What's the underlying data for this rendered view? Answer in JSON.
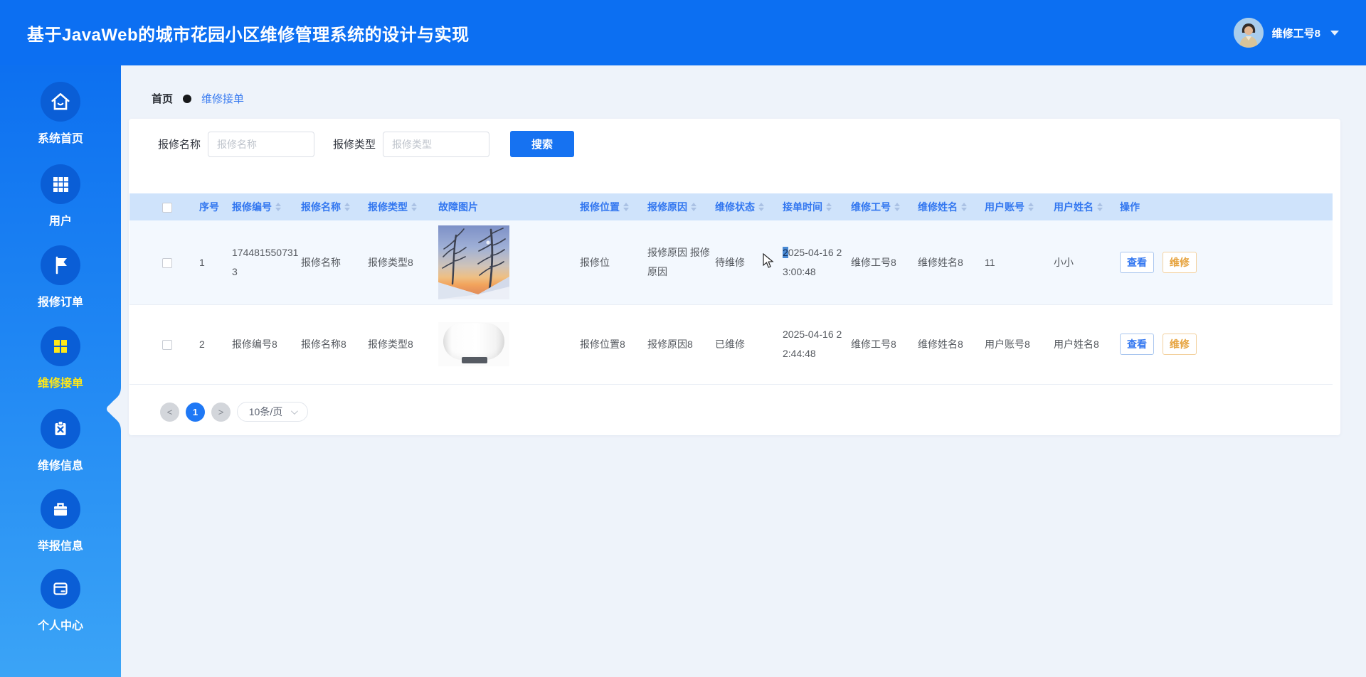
{
  "header": {
    "title": "基于JavaWeb的城市花园小区维修管理系统的设计与实现",
    "user_name": "维修工号8"
  },
  "sidebar": {
    "items": [
      {
        "label": "系统首页",
        "icon": "home"
      },
      {
        "label": "用户",
        "icon": "grid-3x3"
      },
      {
        "label": "报修订单",
        "icon": "flag"
      },
      {
        "label": "维修接单",
        "icon": "grid-2x2",
        "active": true
      },
      {
        "label": "维修信息",
        "icon": "clipboard-x"
      },
      {
        "label": "举报信息",
        "icon": "briefcase"
      },
      {
        "label": "个人中心",
        "icon": "id-card"
      }
    ]
  },
  "breadcrumb": {
    "home": "首页",
    "current": "维修接单"
  },
  "filters": {
    "name_label": "报修名称",
    "name_placeholder": "报修名称",
    "type_label": "报修类型",
    "type_placeholder": "报修类型",
    "search_button": "搜索"
  },
  "table": {
    "columns": [
      "序号",
      "报修编号",
      "报修名称",
      "报修类型",
      "故障图片",
      "报修位置",
      "报修原因",
      "维修状态",
      "接单时间",
      "维修工号",
      "维修姓名",
      "用户账号",
      "用户姓名",
      "操作"
    ],
    "action_view": "查看",
    "action_repair": "维修",
    "rows": [
      {
        "index": "1",
        "repair_no": "174481550731\n3",
        "repair_name": "报修名称",
        "repair_type": "报修类型8",
        "image": "winter-trees-sunset-photo",
        "location": "报修位",
        "reason": "报修原因 报修\n原因",
        "status": "待维修",
        "time_selected": "2",
        "time_rest": "025-04-16 2\n3:00:48",
        "worker_no": "维修工号8",
        "worker_name": "维修姓名8",
        "user_account": "11",
        "user_name": "小小"
      },
      {
        "index": "2",
        "repair_no": "报修编号8",
        "repair_name": "报修名称8",
        "repair_type": "报修类型8",
        "image": "water-heater-photo",
        "location": "报修位置8",
        "reason": "报修原因8",
        "status": "已维修",
        "time": "2025-04-16 2\n2:44:48",
        "worker_no": "维修工号8",
        "worker_name": "维修姓名8",
        "user_account": "用户账号8",
        "user_name": "用户姓名8"
      }
    ]
  },
  "pagination": {
    "prev": "<",
    "page": "1",
    "next": ">",
    "page_size": "10条/页"
  },
  "colors": {
    "primary": "#0c6ff2",
    "sidebar_gradient_bottom": "#3ba4f6",
    "icon_circle": "#0a5ed6",
    "active_menu_yellow": "#ffe817",
    "table_header_bg": "#cfe3fb",
    "table_header_text": "#3377f0",
    "view_button": "#3377f0",
    "repair_button": "#e6a23c",
    "row1_bg": "#f3f8fe"
  }
}
